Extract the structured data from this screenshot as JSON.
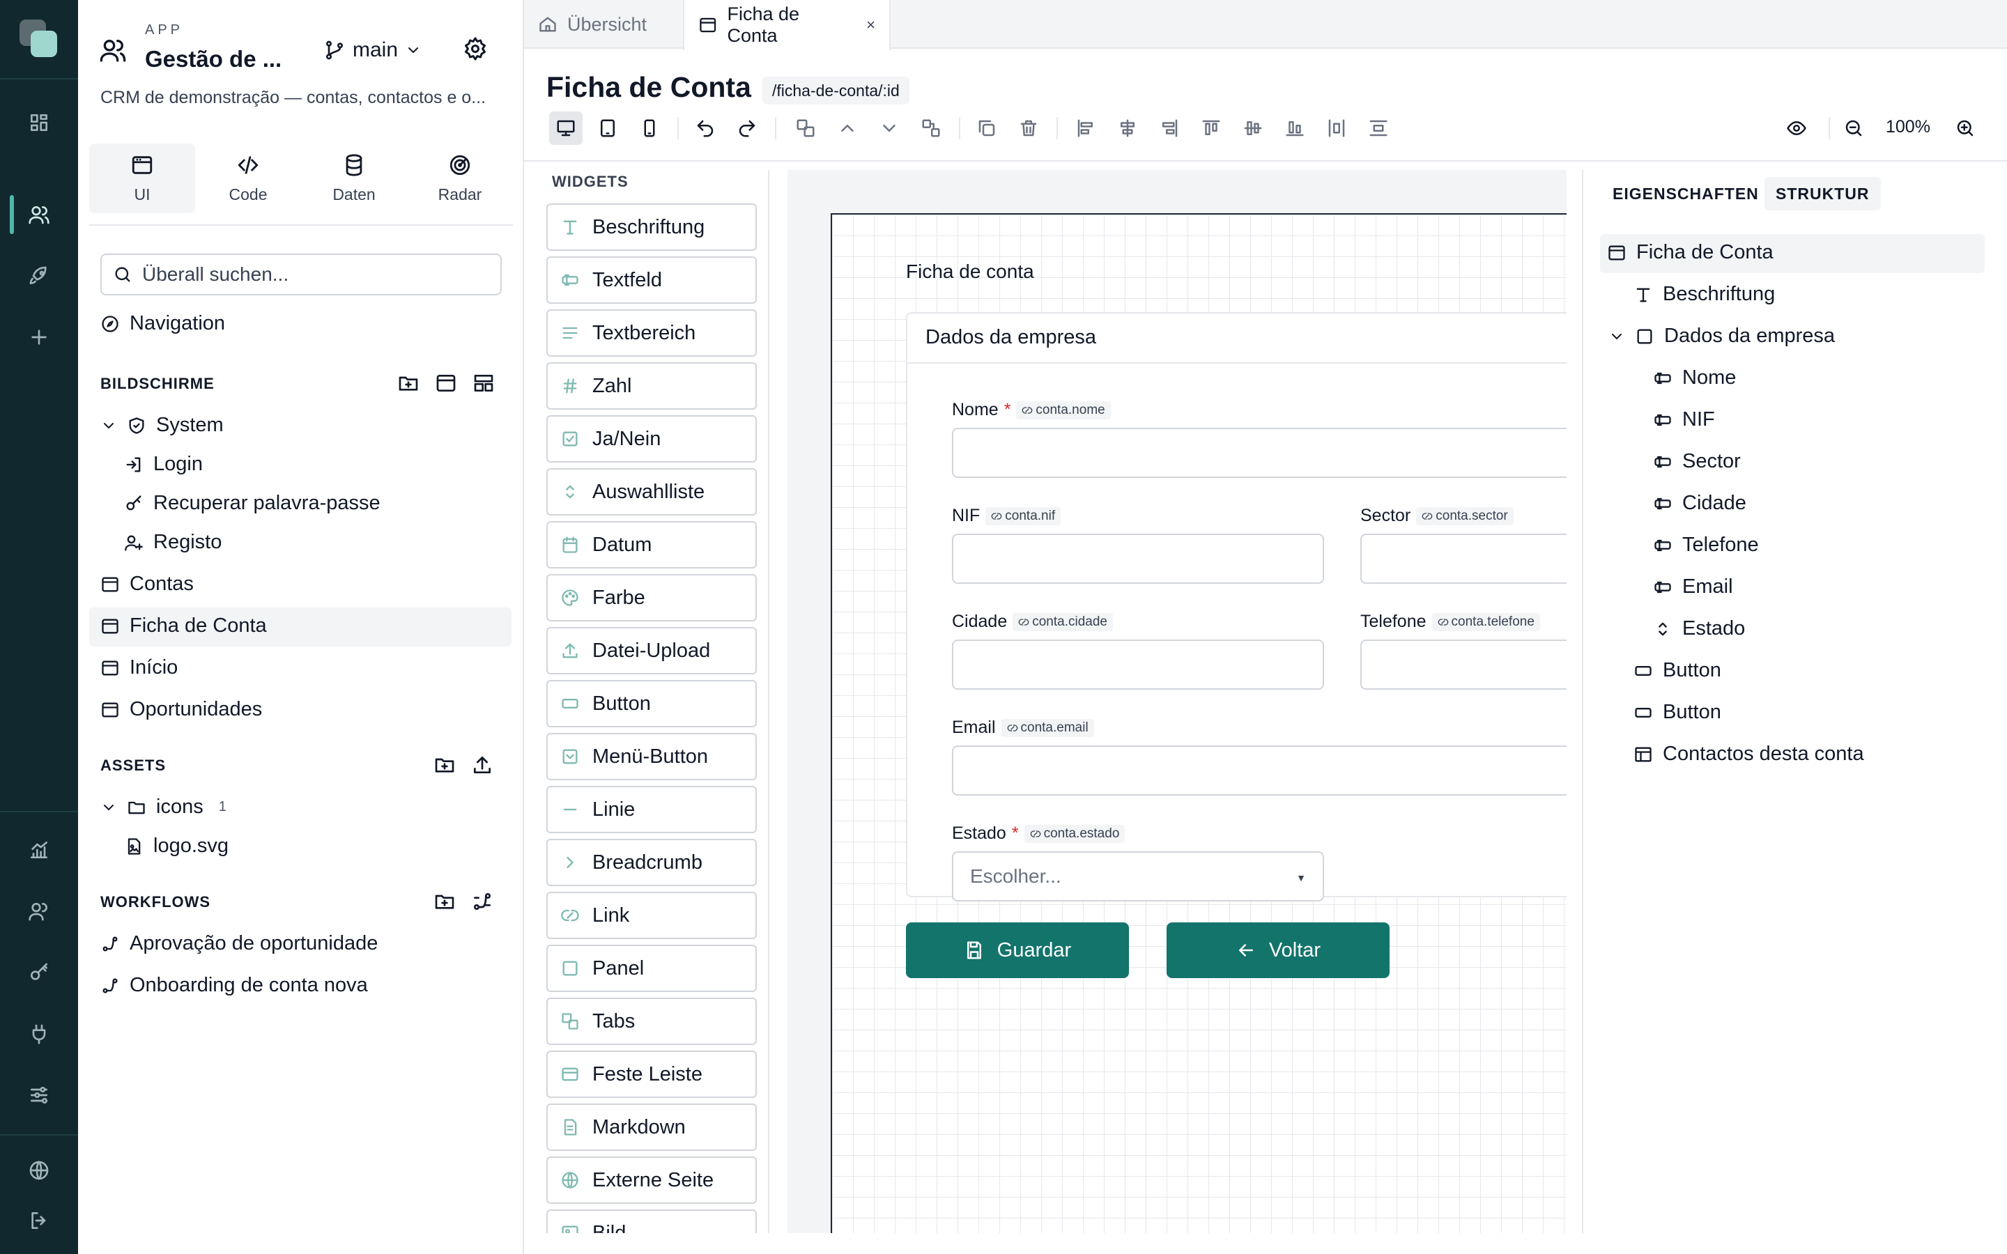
{
  "app": {
    "label": "APP",
    "title": "Gestão de ...",
    "description": "CRM de demonstração — contas, contactos e o...",
    "branch": "main"
  },
  "modes": [
    {
      "label": "UI",
      "icon": "window-icon"
    },
    {
      "label": "Code",
      "icon": "code-icon"
    },
    {
      "label": "Daten",
      "icon": "database-icon"
    },
    {
      "label": "Radar",
      "icon": "radar-icon"
    }
  ],
  "search": {
    "placeholder": "Überall suchen..."
  },
  "navigation_label": "Navigation",
  "screens": {
    "title": "BILDSCHIRME",
    "folder": "System",
    "system_items": [
      "Login",
      "Recuperar palavra-passe",
      "Registo"
    ],
    "items": [
      "Contas",
      "Ficha de Conta",
      "Início",
      "Oportunidades"
    ],
    "selected": "Ficha de Conta"
  },
  "assets": {
    "title": "ASSETS",
    "folder": "icons",
    "folder_count": "1",
    "files": [
      "logo.svg"
    ]
  },
  "workflows": {
    "title": "WORKFLOWS",
    "items": [
      "Aprovação de oportunidade",
      "Onboarding de conta nova"
    ]
  },
  "tabs": [
    {
      "label": "Übersicht",
      "active": false
    },
    {
      "label": "Ficha de Conta",
      "active": true,
      "close": "×"
    }
  ],
  "screen": {
    "title": "Ficha de Conta",
    "route": "/ficha-de-conta/:id",
    "zoom": "100%"
  },
  "widgets": {
    "title": "WIDGETS",
    "items": [
      "Beschriftung",
      "Textfeld",
      "Textbereich",
      "Zahl",
      "Ja/Nein",
      "Auswahlliste",
      "Datum",
      "Farbe",
      "Datei-Upload",
      "Button",
      "Menü-Button",
      "Linie",
      "Breadcrumb",
      "Link",
      "Panel",
      "Tabs",
      "Feste Leiste",
      "Markdown",
      "Externe Seite",
      "Bild"
    ]
  },
  "canvas": {
    "label": "Ficha de conta",
    "panel_title": "Dados da empresa",
    "fields": {
      "nome": {
        "label": "Nome",
        "required": "*",
        "binding": "conta.nome"
      },
      "nif": {
        "label": "NIF",
        "binding": "conta.nif"
      },
      "sector": {
        "label": "Sector",
        "binding": "conta.sector"
      },
      "cidade": {
        "label": "Cidade",
        "binding": "conta.cidade"
      },
      "telefone": {
        "label": "Telefone",
        "binding": "conta.telefone"
      },
      "email": {
        "label": "Email",
        "binding": "conta.email"
      },
      "estado": {
        "label": "Estado",
        "required": "*",
        "binding": "conta.estado",
        "placeholder": "Escolher..."
      }
    },
    "buttons": {
      "save": "Guardar",
      "back": "Voltar"
    }
  },
  "right_panel": {
    "tabs": [
      "EIGENSCHAFTEN",
      "STRUKTUR"
    ],
    "active_tab": "STRUKTUR",
    "tree": [
      "Ficha de Conta",
      "Beschriftung",
      "Dados da empresa",
      "Nome",
      "NIF",
      "Sector",
      "Cidade",
      "Telefone",
      "Email",
      "Estado",
      "Button",
      "Button",
      "Contactos desta conta"
    ]
  },
  "colors": {
    "accent": "#13746b",
    "rail": "#10282e",
    "required": "#dc2626"
  }
}
